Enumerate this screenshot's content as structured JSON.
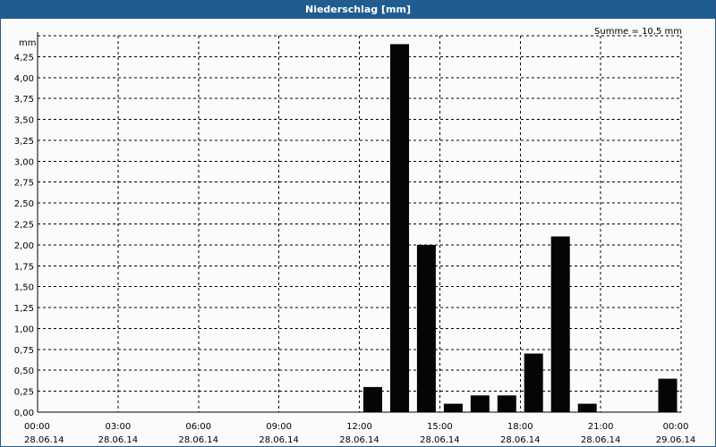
{
  "window": {
    "title": "Niederschlag [mm]"
  },
  "chart_data": {
    "type": "bar",
    "title": "Niederschlag [mm]",
    "ylabel": "mm",
    "annotation": "Summe = 10,5 mm",
    "ylim": [
      0,
      4.5
    ],
    "yticks": [
      "0,00",
      "0,25",
      "0,50",
      "0,75",
      "1,00",
      "1,25",
      "1,50",
      "1,75",
      "2,00",
      "2,25",
      "2,50",
      "2,75",
      "3,00",
      "3,25",
      "3,50",
      "3,75",
      "4,00",
      "4,25"
    ],
    "x_range_hours": [
      0,
      24
    ],
    "xticks": [
      {
        "time": "00:00",
        "date": "28.06.14"
      },
      {
        "time": "03:00",
        "date": "28.06.14"
      },
      {
        "time": "06:00",
        "date": "28.06.14"
      },
      {
        "time": "09:00",
        "date": "28.06.14"
      },
      {
        "time": "12:00",
        "date": "28.06.14"
      },
      {
        "time": "15:00",
        "date": "28.06.14"
      },
      {
        "time": "18:00",
        "date": "28.06.14"
      },
      {
        "time": "21:00",
        "date": "28.06.14"
      },
      {
        "time": "00:00",
        "date": "29.06.14"
      }
    ],
    "hours": [
      "00:00",
      "01:00",
      "02:00",
      "03:00",
      "04:00",
      "05:00",
      "06:00",
      "07:00",
      "08:00",
      "09:00",
      "10:00",
      "11:00",
      "12:00",
      "13:00",
      "14:00",
      "15:00",
      "16:00",
      "17:00",
      "18:00",
      "19:00",
      "20:00",
      "21:00",
      "22:00",
      "23:00"
    ],
    "values": [
      0,
      0,
      0,
      0,
      0,
      0,
      0,
      0,
      0,
      0,
      0,
      0,
      0.3,
      4.4,
      2.0,
      0.1,
      0.2,
      0.2,
      0.7,
      2.1,
      0.1,
      0,
      0,
      0.4
    ],
    "bar_color": "#050505",
    "grid": true
  }
}
